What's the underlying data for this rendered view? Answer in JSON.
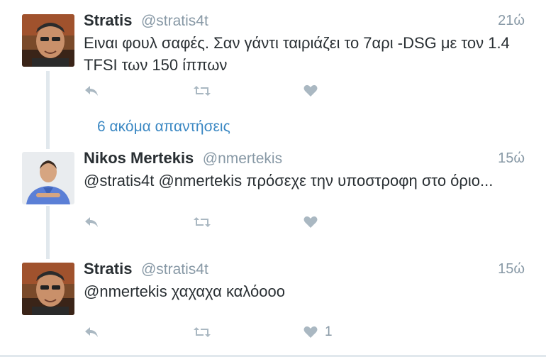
{
  "tweets": [
    {
      "name": "Stratis",
      "handle": "@stratis4t",
      "time": "21ώ",
      "text": "Ειναι φουλ σαφές. Σαν γάντι ταιριάζει το 7αρι -DSG με τον 1.4 TFSI των 150 ίππων",
      "like_count": ""
    },
    {
      "name": "Nikos Mertekis",
      "handle": "@nmertekis",
      "time": "15ώ",
      "text": "@stratis4t @nmertekis πρόσεχε την υποστροφη στο όριο...",
      "like_count": ""
    },
    {
      "name": "Stratis",
      "handle": "@stratis4t",
      "time": "15ώ",
      "text": "@nmertekis χαχαχα καλόοοο",
      "like_count": "1"
    }
  ],
  "more_replies": "6 ακόμα απαντήσεις",
  "icons": {
    "reply": "reply-icon",
    "retweet": "retweet-icon",
    "like": "heart-icon"
  },
  "colors": {
    "text": "#292f33",
    "muted": "#8899a6",
    "link": "#3b88c3",
    "icon": "#aab8c2",
    "thread_line": "#e1e8ed"
  }
}
